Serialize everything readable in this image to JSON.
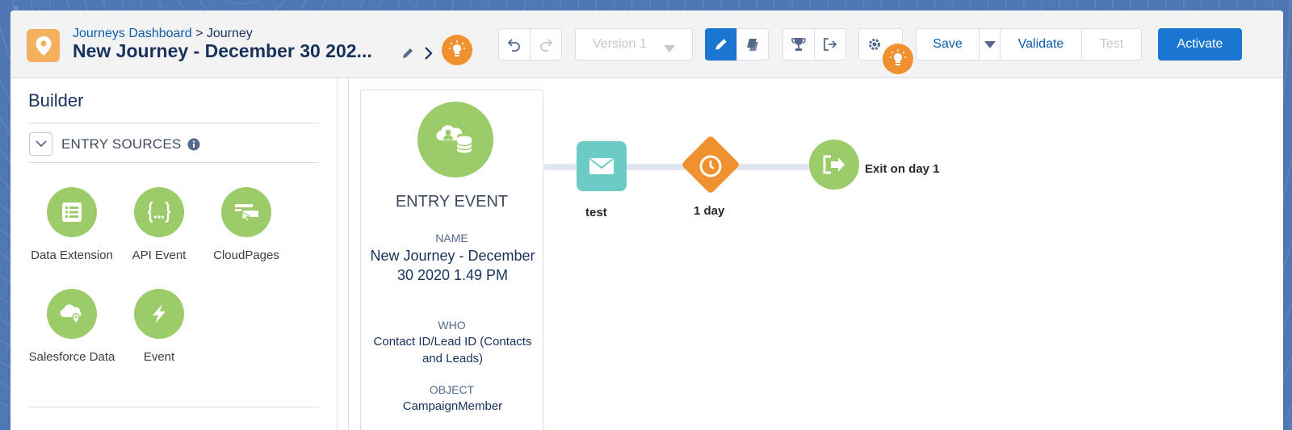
{
  "header": {
    "breadcrumb_link": "Journeys Dashboard",
    "breadcrumb_separator": " > ",
    "breadcrumb_current": "Journey",
    "title": "New Journey - December 30 202...",
    "version_label": "Version 1",
    "save_label": "Save",
    "validate_label": "Validate",
    "test_label": "Test",
    "activate_label": "Activate"
  },
  "sidebar": {
    "title": "Builder",
    "section_label": "ENTRY SOURCES",
    "sources": [
      {
        "label": "Data Extension",
        "icon": "table-icon"
      },
      {
        "label": "API Event",
        "icon": "api-braces-icon"
      },
      {
        "label": "CloudPages",
        "icon": "cloudpages-icon"
      },
      {
        "label": "Salesforce Data",
        "icon": "salesforce-cloud-icon"
      },
      {
        "label": "Event",
        "icon": "lightning-icon"
      }
    ]
  },
  "canvas": {
    "entry": {
      "title": "ENTRY EVENT",
      "name_label": "NAME",
      "name_value": "New Journey - December 30 2020 1.49 PM",
      "who_label": "WHO",
      "who_value": "Contact ID/Lead ID (Contacts and Leads)",
      "object_label": "OBJECT",
      "object_value": "CampaignMember"
    },
    "email_label": "test",
    "wait_label": "1 day",
    "exit_label": "Exit on day 1"
  },
  "colors": {
    "accent_blue": "#1b76d1",
    "link_blue": "#0b5cab",
    "green": "#9ccb6a",
    "teal": "#6ccbc4",
    "orange": "#f0902e"
  }
}
